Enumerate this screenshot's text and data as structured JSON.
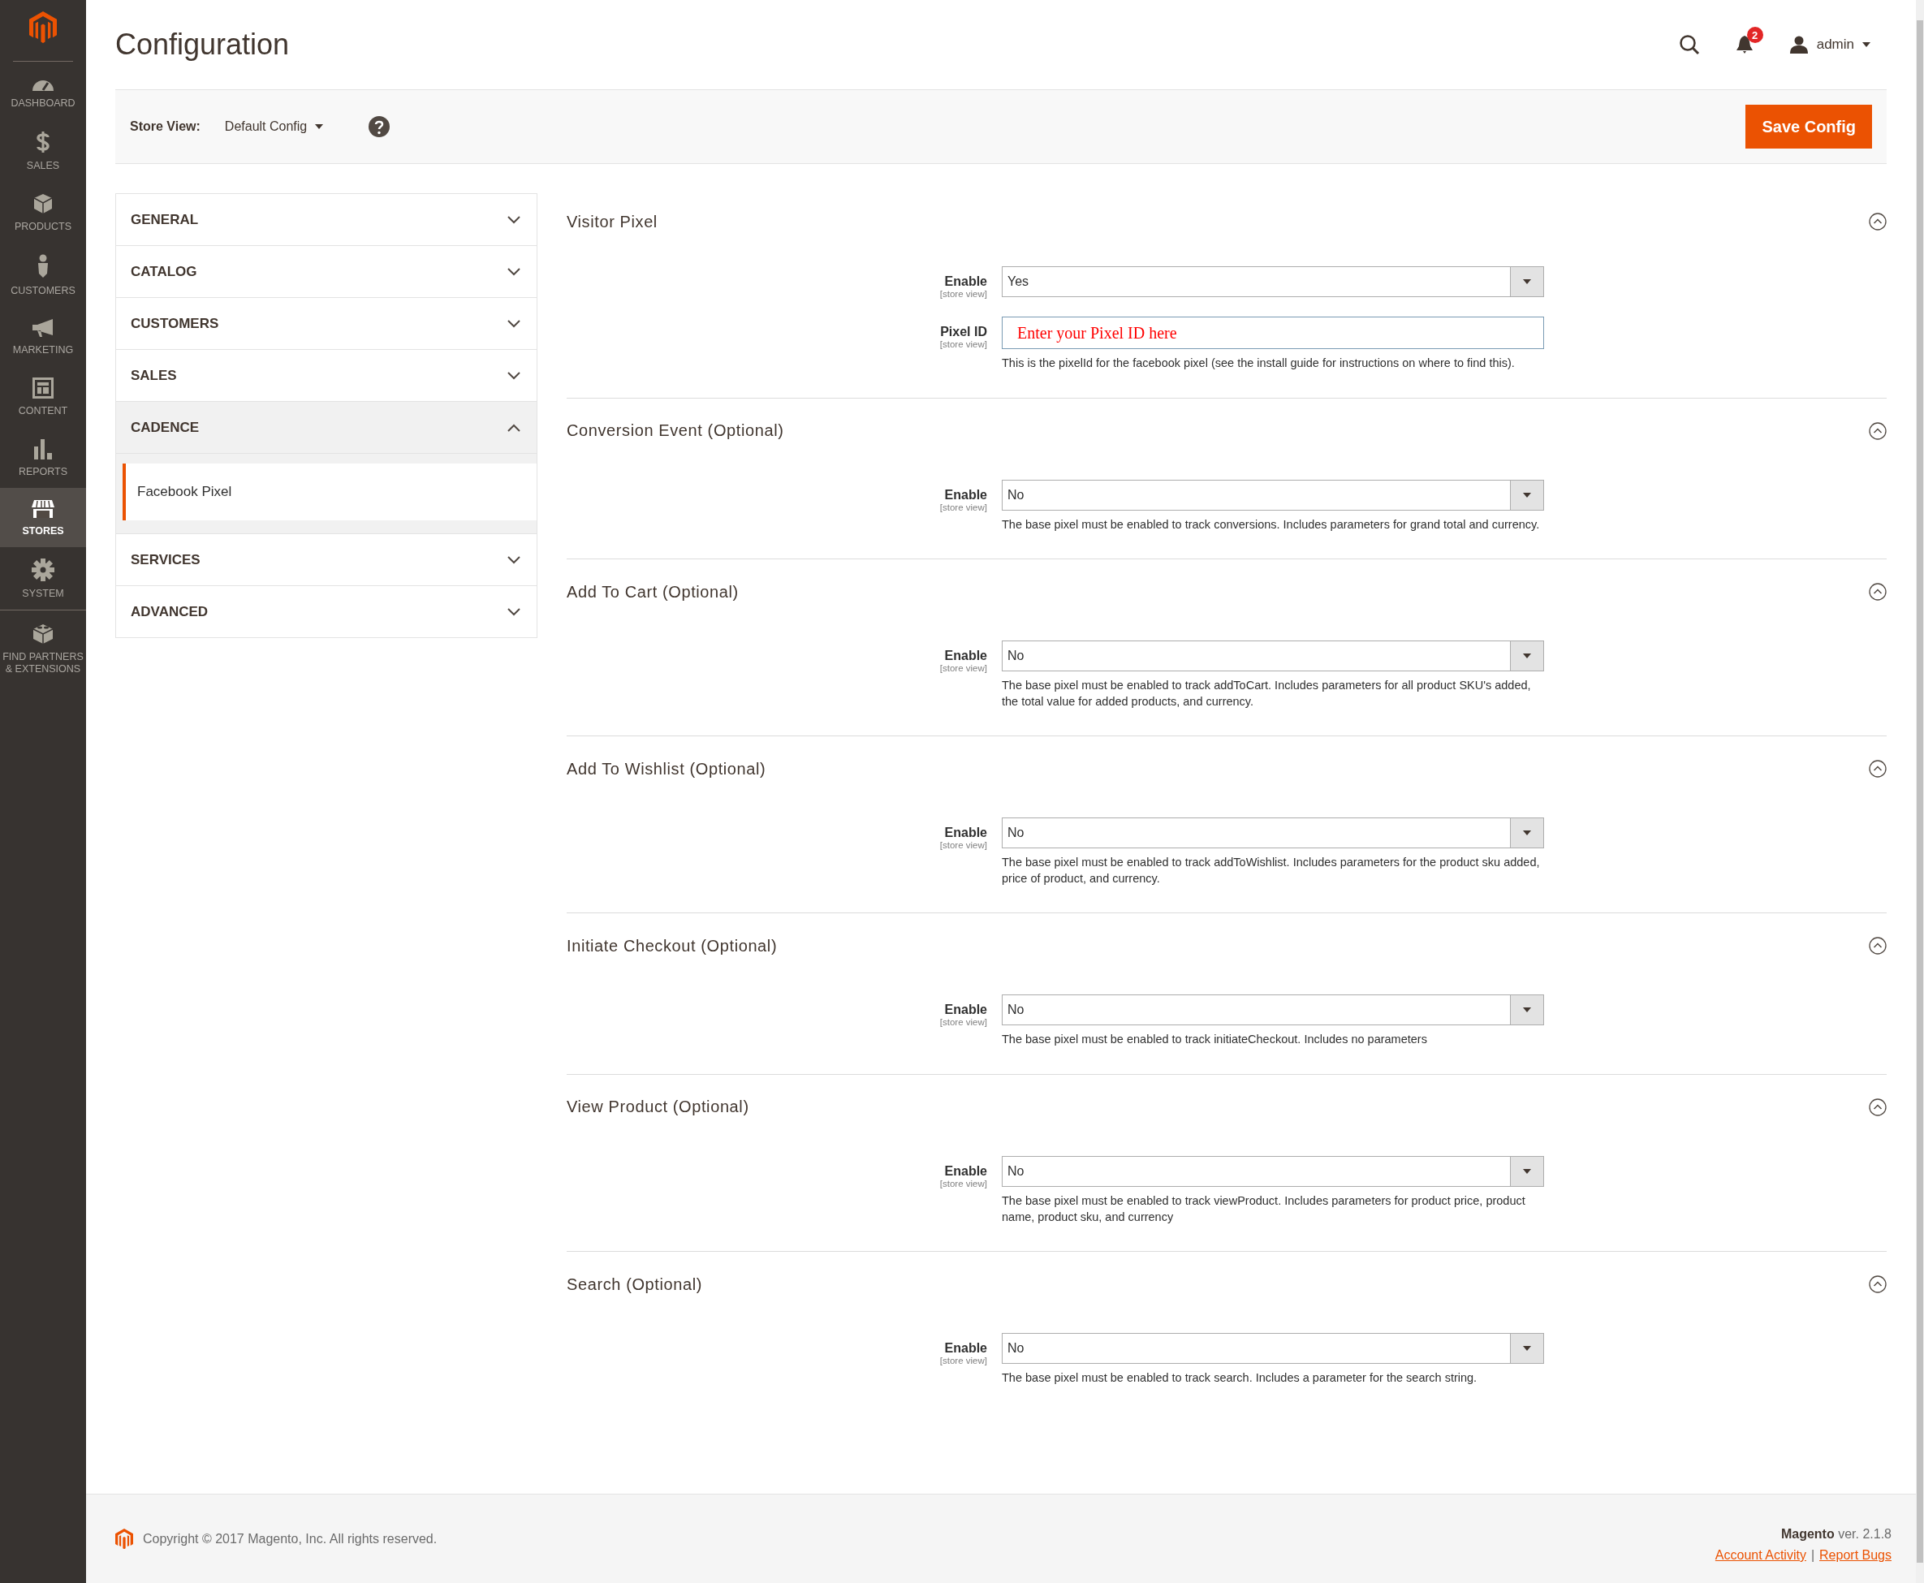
{
  "menu": [
    {
      "kind": "dashboard",
      "label": "DASHBOARD",
      "selected": false
    },
    {
      "kind": "sales",
      "label": "SALES",
      "selected": false
    },
    {
      "kind": "products",
      "label": "PRODUCTS",
      "selected": false
    },
    {
      "kind": "customers",
      "label": "CUSTOMERS",
      "selected": false
    },
    {
      "kind": "marketing",
      "label": "MARKETING",
      "selected": false
    },
    {
      "kind": "content",
      "label": "CONTENT",
      "selected": false
    },
    {
      "kind": "reports",
      "label": "REPORTS",
      "selected": false
    },
    {
      "kind": "stores",
      "label": "STORES",
      "selected": true
    },
    {
      "kind": "system",
      "label": "SYSTEM",
      "selected": false
    },
    {
      "kind": "extensions",
      "label": "FIND PARTNERS & EXTENSIONS",
      "selected": false
    }
  ],
  "page_title": "Configuration",
  "header": {
    "notifications": "2",
    "user": "admin"
  },
  "toolbar": {
    "store_view_label": "Store View:",
    "store_view": "Default Config",
    "save_button": "Save Config"
  },
  "nav": [
    {
      "label": "GENERAL",
      "expanded": false
    },
    {
      "label": "CATALOG",
      "expanded": false
    },
    {
      "label": "CUSTOMERS",
      "expanded": false
    },
    {
      "label": "SALES",
      "expanded": false
    },
    {
      "label": "CADENCE",
      "expanded": true,
      "children": [
        {
          "label": "Facebook Pixel",
          "selected": true
        }
      ]
    },
    {
      "label": "SERVICES",
      "expanded": false
    },
    {
      "label": "ADVANCED",
      "expanded": false
    }
  ],
  "sections": [
    {
      "title": "Visitor Pixel",
      "expanded": true,
      "fields": [
        {
          "kind": "select",
          "label": "Enable",
          "scope": "[store view]",
          "value": "Yes"
        },
        {
          "kind": "text",
          "label": "Pixel ID",
          "scope": "[store view]",
          "value": "Enter your Pixel ID here",
          "note": "This is the pixelId for the facebook pixel (see the install guide for instructions on where to find this)."
        }
      ]
    },
    {
      "title": "Conversion Event (Optional)",
      "expanded": true,
      "fields": [
        {
          "kind": "select",
          "label": "Enable",
          "scope": "[store view]",
          "value": "No",
          "note": "The base pixel must be enabled to track conversions. Includes parameters for grand total and currency."
        }
      ]
    },
    {
      "title": "Add To Cart (Optional)",
      "expanded": true,
      "fields": [
        {
          "kind": "select",
          "label": "Enable",
          "scope": "[store view]",
          "value": "No",
          "note": "The base pixel must be enabled to track addToCart. Includes parameters for all product SKU's added, the total value for added products, and currency."
        }
      ]
    },
    {
      "title": "Add To Wishlist (Optional)",
      "expanded": true,
      "fields": [
        {
          "kind": "select",
          "label": "Enable",
          "scope": "[store view]",
          "value": "No",
          "note": "The base pixel must be enabled to track addToWishlist. Includes parameters for the product sku added, price of product, and currency."
        }
      ]
    },
    {
      "title": "Initiate Checkout (Optional)",
      "expanded": true,
      "fields": [
        {
          "kind": "select",
          "label": "Enable",
          "scope": "[store view]",
          "value": "No",
          "note": "The base pixel must be enabled to track initiateCheckout. Includes no parameters"
        }
      ]
    },
    {
      "title": "View Product (Optional)",
      "expanded": true,
      "fields": [
        {
          "kind": "select",
          "label": "Enable",
          "scope": "[store view]",
          "value": "No",
          "note": "The base pixel must be enabled to track viewProduct. Includes parameters for product price, product name, product sku, and currency"
        }
      ]
    },
    {
      "title": "Search (Optional)",
      "expanded": true,
      "fields": [
        {
          "kind": "select",
          "label": "Enable",
          "scope": "[store view]",
          "value": "No",
          "note": "The base pixel must be enabled to track search. Includes a parameter for the search string."
        }
      ]
    }
  ],
  "footer": {
    "copyright": "Copyright © 2017 Magento, Inc. All rights reserved.",
    "brand": "Magento",
    "version": "ver. 2.1.8",
    "links": [
      "Account Activity",
      "Report Bugs"
    ],
    "link_separator": "|"
  }
}
